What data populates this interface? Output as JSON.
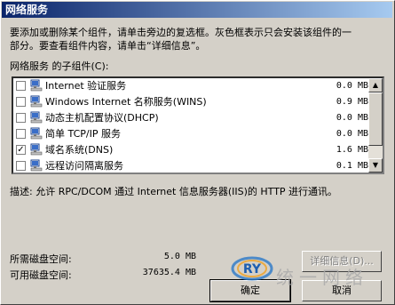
{
  "window": {
    "title": "网络服务"
  },
  "instructions": {
    "line1": "要添加或删除某个组件，请单击旁边的复选框。灰色框表示只会安装该组件的一",
    "line2": "部分。要查看组件内容，请单击“详细信息”。"
  },
  "subcomponents_label": "网络服务 的子组件(C):",
  "components": [
    {
      "name": "Internet 验证服务",
      "size": "0.0 MB",
      "checked": false
    },
    {
      "name": "Windows Internet 名称服务(WINS)",
      "size": "0.9 MB",
      "checked": false
    },
    {
      "name": "动态主机配置协议(DHCP)",
      "size": "0.0 MB",
      "checked": false
    },
    {
      "name": "简单 TCP/IP 服务",
      "size": "0.0 MB",
      "checked": false
    },
    {
      "name": "域名系统(DNS)",
      "size": "1.6 MB",
      "checked": true
    },
    {
      "name": "远程访问隔离服务",
      "size": "0.1 MB",
      "checked": false
    }
  ],
  "description": {
    "label": "描述:",
    "text": "允许 RPC/DCOM 通过 Internet 信息服务器(IIS)的 HTTP 进行通讯。"
  },
  "disk": {
    "required_label": "所需磁盘空间:",
    "required_value": "5.0 MB",
    "available_label": "可用磁盘空间:",
    "available_value": "37635.4 MB"
  },
  "buttons": {
    "details": "详细信息(D)...",
    "ok": "确定",
    "cancel": "取消"
  },
  "watermark": {
    "logo_text": "RY",
    "text": "统一网络"
  },
  "colors": {
    "title_start": "#0a246a",
    "title_end": "#a6caf0",
    "dialog_bg": "#d4d0c8"
  }
}
